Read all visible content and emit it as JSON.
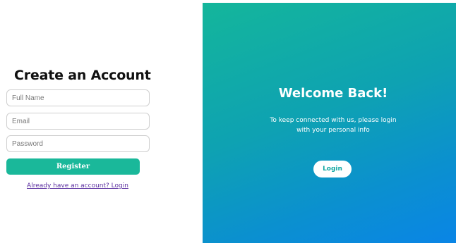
{
  "register": {
    "title": "Create an Account",
    "full_name": {
      "placeholder": "Full Name",
      "value": ""
    },
    "email": {
      "placeholder": "Email",
      "value": ""
    },
    "password": {
      "placeholder": "Password",
      "value": ""
    },
    "register_label": "Register",
    "login_link": "Already have an account? Login"
  },
  "welcome": {
    "title": "Welcome Back!",
    "text": "To keep connected with us, please login with your personal info",
    "login_label": "Login"
  },
  "colors": {
    "accent": "#1ab89a",
    "link": "#5b2fa0",
    "gradient_start": "#14b69b",
    "gradient_end": "#0a85e6"
  }
}
